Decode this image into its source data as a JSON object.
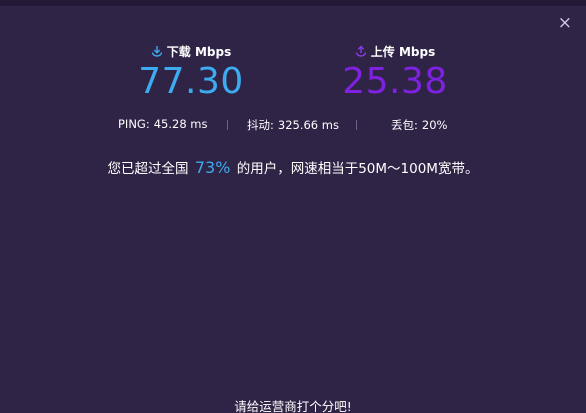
{
  "close": {
    "symbol": "×"
  },
  "download": {
    "label": "下载 Mbps",
    "value": "77.30",
    "icon": "download-icon",
    "color": "#3dabf0"
  },
  "upload": {
    "label": "上传 Mbps",
    "value": "25.38",
    "icon": "upload-icon",
    "color": "#7e22e0"
  },
  "stats": {
    "ping": {
      "label": "PING:",
      "value": "45.28 ms"
    },
    "jitter": {
      "label": "抖动:",
      "value": "325.66 ms"
    },
    "loss": {
      "label": "丢包:",
      "value": "20%"
    }
  },
  "summary": {
    "prefix": "您已超过全国",
    "percent": "73%",
    "suffix": "的用户，网速相当于50M～100M宽带。"
  },
  "rate_prompt": "请给运营商打个分吧!"
}
